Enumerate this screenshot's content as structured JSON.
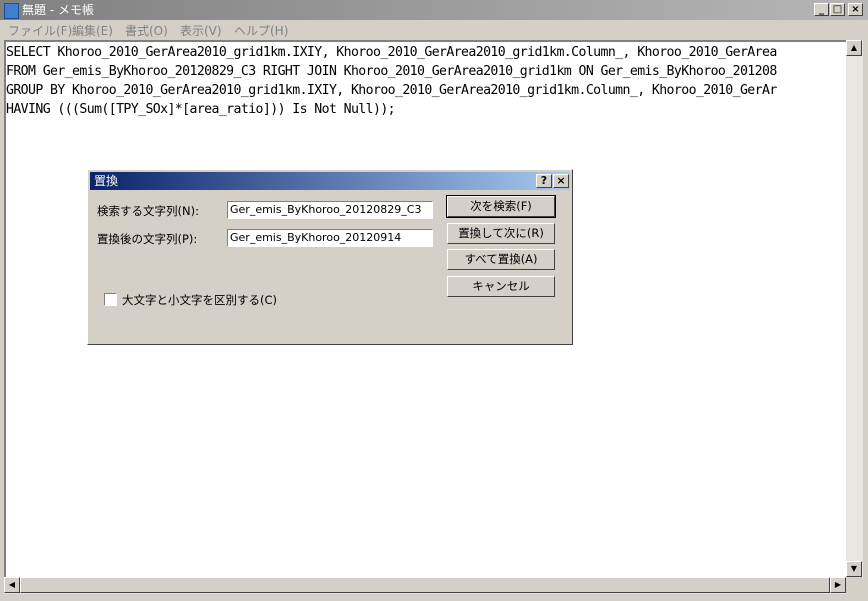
{
  "window": {
    "title": "無題 - メモ帳",
    "buttons": {
      "minimize": "_",
      "maximize": "□",
      "close": "×"
    }
  },
  "menu": [
    "ファイル(F)",
    "編集(E)",
    "書式(O)",
    "表示(V)",
    "ヘルプ(H)"
  ],
  "editor": {
    "lines": [
      "SELECT Khoroo_2010_GerArea2010_grid1km.IXIY, Khoroo_2010_GerArea2010_grid1km.Column_, Khoroo_2010_GerArea",
      "FROM Ger_emis_ByKhoroo_20120829_C3 RIGHT JOIN Khoroo_2010_GerArea2010_grid1km ON Ger_emis_ByKhoroo_201208",
      "GROUP BY Khoroo_2010_GerArea2010_grid1km.IXIY, Khoroo_2010_GerArea2010_grid1km.Column_, Khoroo_2010_GerAr",
      "HAVING (((Sum([TPY_SOx]*[area_ratio])) Is Not Null));"
    ]
  },
  "dialog": {
    "title": "置換",
    "help_button": "?",
    "close_button": "×",
    "find_label": "検索する文字列(N):",
    "find_value": "Ger_emis_ByKhoroo_20120829_C3",
    "replace_label": "置換後の文字列(P):",
    "replace_value": "Ger_emis_ByKhoroo_20120914",
    "match_case_label": "大文字と小文字を区別する(C)",
    "match_case_checked": false,
    "buttons": {
      "find_next": "次を検索(F)",
      "replace": "置換して次に(R)",
      "replace_all": "すべて置換(A)",
      "cancel": "キャンセル"
    }
  },
  "scroll": {
    "up": "▲",
    "down": "▼",
    "left": "◀",
    "right": "▶"
  }
}
